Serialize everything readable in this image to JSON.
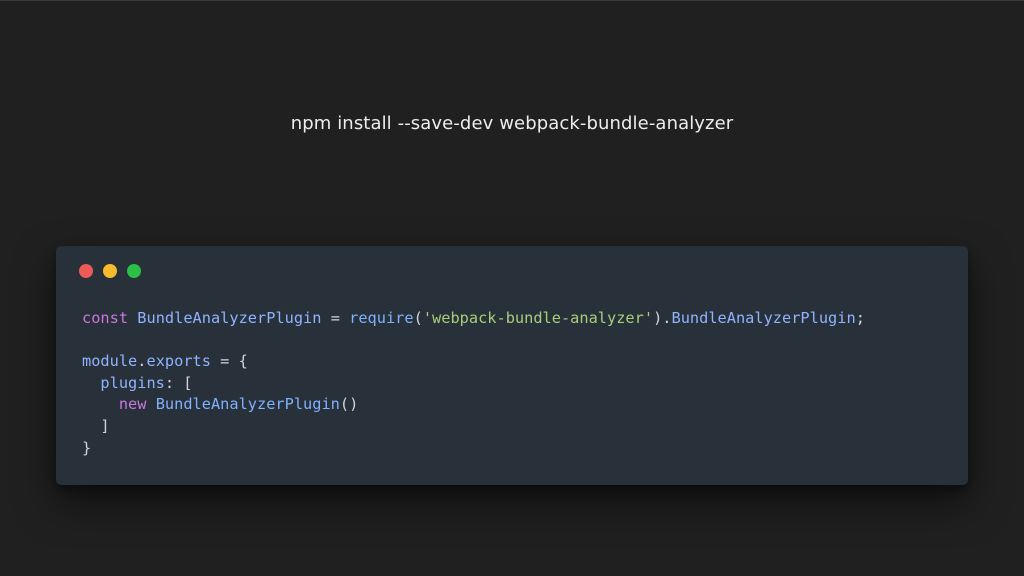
{
  "command": "npm install --save-dev webpack-bundle-analyzer",
  "window_controls": {
    "close_color": "#ee5b57",
    "minimize_color": "#f7bb2e",
    "maximize_color": "#2bbf46"
  },
  "code": {
    "line1": {
      "keyword": "const",
      "variable": "BundleAnalyzerPlugin",
      "equals": " = ",
      "call": "require",
      "open_paren": "(",
      "string": "'webpack-bundle-analyzer'",
      "close_paren_dot": ").",
      "property": "BundleAnalyzerPlugin",
      "semicolon": ";"
    },
    "line3": {
      "object": "module",
      "dot": ".",
      "property": "exports",
      "rest": " = {"
    },
    "line4": {
      "indent": "  ",
      "property": "plugins",
      "rest": ": ["
    },
    "line5": {
      "indent": "    ",
      "keyword": "new",
      "space": " ",
      "constructor": "BundleAnalyzerPlugin",
      "parens": "()"
    },
    "line6": {
      "text": "  ]"
    },
    "line7": {
      "text": "}"
    }
  }
}
